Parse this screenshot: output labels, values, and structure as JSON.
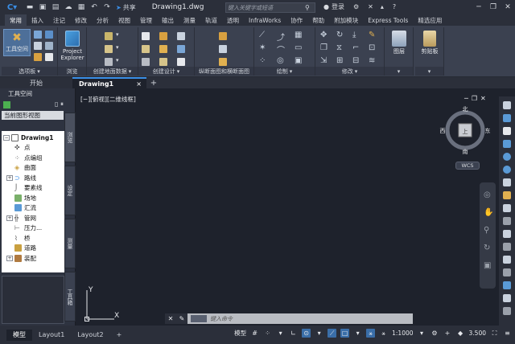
{
  "titlebar": {
    "logo": "C",
    "share_label": "共享",
    "document_title": "Drawing1.dwg",
    "search_placeholder": "键入关键字或短语",
    "login_label": "登录"
  },
  "ribbon_tabs": [
    "常用",
    "插入",
    "注记",
    "修改",
    "分析",
    "视图",
    "管理",
    "输出",
    "测量",
    "轨道",
    "透明",
    "InfraWorks",
    "协作",
    "帮助",
    "附加模块",
    "Express Tools",
    "精选应用"
  ],
  "active_tab": "常用",
  "panels": {
    "palettes": {
      "title": "选项板",
      "big_button": "工具空间"
    },
    "explore": {
      "title": "浏览",
      "big_button_line1": "Project",
      "big_button_line2": "Explorer"
    },
    "ground_data": {
      "title": "创建地面数据"
    },
    "design": {
      "title": "创建设计"
    },
    "profile_section": {
      "title": "纵断面图和横断面图"
    },
    "draw": {
      "title": "绘制"
    },
    "modify": {
      "title": "修改"
    },
    "layers": {
      "title": "图层"
    },
    "clipboard": {
      "title": "剪贴板"
    }
  },
  "file_tabs": {
    "start": "开始",
    "drawing": "Drawing1",
    "close": "×",
    "add": "+"
  },
  "toolspace": {
    "header": "工具空间",
    "view_label": "当前图形视图",
    "tree": [
      {
        "label": "Drawing1",
        "level": 0,
        "expander": "−",
        "bold": true
      },
      {
        "label": "点",
        "level": 1,
        "expander": ""
      },
      {
        "label": "点编组",
        "level": 1,
        "expander": ""
      },
      {
        "label": "曲面",
        "level": 1,
        "expander": ""
      },
      {
        "label": "路线",
        "level": 1,
        "expander": "+"
      },
      {
        "label": "要素线",
        "level": 1,
        "expander": ""
      },
      {
        "label": "场地",
        "level": 1,
        "expander": ""
      },
      {
        "label": "汇流",
        "level": 1,
        "expander": ""
      },
      {
        "label": "管网",
        "level": 1,
        "expander": "+"
      },
      {
        "label": "压力...",
        "level": 1,
        "expander": ""
      },
      {
        "label": "桥",
        "level": 1,
        "expander": ""
      },
      {
        "label": "道路",
        "level": 1,
        "expander": ""
      },
      {
        "label": "装配",
        "level": 1,
        "expander": "+"
      }
    ],
    "vertical_tabs": [
      "浏览",
      "设定",
      "测量",
      "工具箱"
    ]
  },
  "canvas": {
    "view_label": "[−][俯视][二维线框]",
    "compass": {
      "north": "北",
      "south": "南",
      "east": "东",
      "west": "西",
      "top": "上"
    },
    "wcs": "WCS",
    "ucs_y": "Y",
    "ucs_x": "X"
  },
  "command_line": {
    "placeholder": "键入命令"
  },
  "layout_tabs": [
    "模型",
    "Layout1",
    "Layout2"
  ],
  "active_layout": "模型",
  "status": {
    "model": "模型",
    "scale": "1:1000",
    "annotation_scale": "3.500"
  },
  "colors": {
    "accent": "#3a8ee6",
    "ribbon": "#3b4150",
    "canvas": "#1e222c"
  }
}
